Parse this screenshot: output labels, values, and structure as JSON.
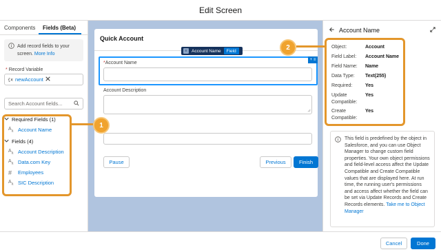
{
  "header": {
    "title": "Edit Screen"
  },
  "left": {
    "tabs": [
      "Components",
      "Fields (Beta)"
    ],
    "info": {
      "text": "Add record fields to your screen.",
      "link": "More Info"
    },
    "record_variable": {
      "label": "Record Variable",
      "value": "newAccount"
    },
    "search": {
      "placeholder": "Search Account fields..."
    },
    "required_group": {
      "label": "Required Fields (1)",
      "items": [
        "Account Name"
      ]
    },
    "fields_group": {
      "label": "Fields (4)",
      "items": [
        {
          "label": "Account Description",
          "icon": "text-field-icon"
        },
        {
          "label": "Data.com Key",
          "icon": "text-field-icon"
        },
        {
          "label": "Employees",
          "icon": "number-field-icon"
        },
        {
          "label": "SIC Description",
          "icon": "text-field-icon"
        }
      ]
    }
  },
  "canvas": {
    "card_title": "Quick Account",
    "chip": {
      "name": "Account Name",
      "type": "Field"
    },
    "fields": [
      {
        "label": "Account Name",
        "required": true
      },
      {
        "label": "Account Description"
      }
    ],
    "buttons": {
      "pause": "Pause",
      "previous": "Previous",
      "finish": "Finish"
    }
  },
  "right": {
    "title": "Account Name",
    "props": [
      {
        "label": "Object:",
        "value": "Account"
      },
      {
        "label": "Field Label:",
        "value": "Account Name"
      },
      {
        "label": "Field Name:",
        "value": "Name"
      },
      {
        "label": "Data Type:",
        "value": "Text(255)"
      },
      {
        "label": "Required:",
        "value": "Yes"
      },
      {
        "label": "Update Compatible:",
        "value": "Yes"
      },
      {
        "label": "Create Compatible:",
        "value": "Yes"
      }
    ],
    "help_text": "This field is predefined by the object in Salesforce, and you can use Object Manager to change custom field properties. Your own object permissions and field-level access affect the Update Compatible and Create Compatible values that are displayed here. At run time, the running user's permissions and access affect whether the field can be set via Update Records and Create Records elements.",
    "help_link": "Take me to Object Manager"
  },
  "footer": {
    "cancel": "Cancel",
    "done": "Done"
  },
  "callouts": [
    "1",
    "2"
  ],
  "colors": {
    "brand": "#0176d3",
    "callout": "#e3962b",
    "canvas_bg": "#b0c4df"
  }
}
